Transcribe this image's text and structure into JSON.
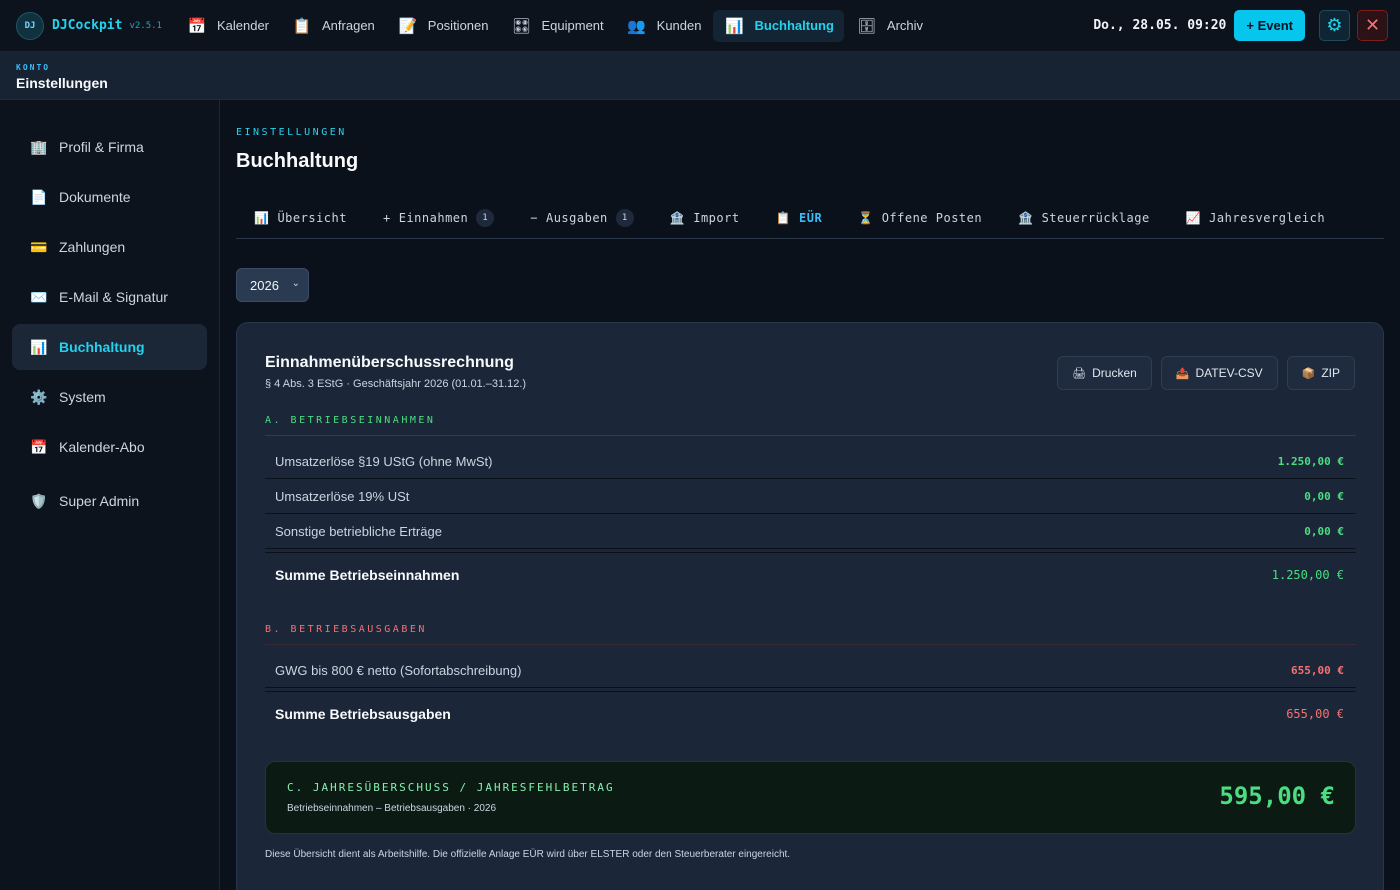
{
  "app": {
    "logo_badge": "DJ",
    "name": "DJCockpit",
    "version": "v2.5.1"
  },
  "nav": [
    {
      "label": "Kalender",
      "icon": "calendar-icon",
      "glyph": "📅"
    },
    {
      "label": "Anfragen",
      "icon": "clipboard-icon",
      "glyph": "📋"
    },
    {
      "label": "Positionen",
      "icon": "memo-icon",
      "glyph": "📝"
    },
    {
      "label": "Equipment",
      "icon": "speaker-icon",
      "glyph": "🎛"
    },
    {
      "label": "Kunden",
      "icon": "people-icon",
      "glyph": "👥"
    },
    {
      "label": "Buchhaltung",
      "icon": "chart-icon",
      "glyph": "📊",
      "active": true
    },
    {
      "label": "Archiv",
      "icon": "archive-icon",
      "glyph": "🗄"
    }
  ],
  "topbar": {
    "datetime": "Do., 28.05. 09:20",
    "event_button": "+ Event"
  },
  "subheader": {
    "kicker": "KONTO",
    "title": "Einstellungen"
  },
  "sidebar": [
    {
      "label": "Profil & Firma",
      "icon": "office-icon",
      "glyph": "🏢"
    },
    {
      "label": "Dokumente",
      "icon": "document-icon",
      "glyph": "📄"
    },
    {
      "label": "Zahlungen",
      "icon": "credit-card-icon",
      "glyph": "💳"
    },
    {
      "label": "E-Mail & Signatur",
      "icon": "mail-icon",
      "glyph": "✉️"
    },
    {
      "label": "Buchhaltung",
      "icon": "chart-icon",
      "glyph": "📊",
      "active": true
    },
    {
      "label": "System",
      "icon": "gear-icon",
      "glyph": "⚙️"
    },
    {
      "label": "Kalender-Abo",
      "icon": "calendar-icon",
      "glyph": "📅"
    },
    {
      "label": "Super Admin",
      "icon": "shield-icon",
      "glyph": "🛡️"
    }
  ],
  "page": {
    "kicker": "EINSTELLUNGEN",
    "title": "Buchhaltung"
  },
  "tabs": [
    {
      "label": "Übersicht",
      "glyph": "📊",
      "icon": "chart-icon"
    },
    {
      "label": "Einnahmen",
      "glyph": "+",
      "icon": "plus-icon",
      "count": "1"
    },
    {
      "label": "Ausgaben",
      "glyph": "−",
      "icon": "minus-icon",
      "count": "1"
    },
    {
      "label": "Import",
      "glyph": "🏦",
      "icon": "bank-icon"
    },
    {
      "label": "EÜR",
      "glyph": "📋",
      "icon": "clipboard-icon",
      "active": true
    },
    {
      "label": "Offene Posten",
      "glyph": "⏳",
      "icon": "hourglass-icon"
    },
    {
      "label": "Steuerrücklage",
      "glyph": "🏦",
      "icon": "bank-icon"
    },
    {
      "label": "Jahresvergleich",
      "glyph": "📈",
      "icon": "trend-icon"
    }
  ],
  "year_select": {
    "value": "2026"
  },
  "report": {
    "title": "Einnahmenüberschussrechnung",
    "subtitle": "§ 4 Abs. 3 EStG · Geschäftsjahr 2026 (01.01.–31.12.)",
    "actions": [
      {
        "label": "Drucken",
        "glyph": "🖨",
        "icon": "printer-icon"
      },
      {
        "label": "DATEV-CSV",
        "glyph": "📤",
        "icon": "export-icon"
      },
      {
        "label": "ZIP",
        "glyph": "📦",
        "icon": "package-icon"
      }
    ],
    "income": {
      "heading": "A. BETRIEBSEINNAHMEN",
      "rows": [
        {
          "label": "Umsatzerlöse §19 UStG (ohne MwSt)",
          "amount": "1.250,00 €"
        },
        {
          "label": "Umsatzerlöse 19% USt",
          "amount": "0,00 €"
        },
        {
          "label": "Sonstige betriebliche Erträge",
          "amount": "0,00 €"
        }
      ],
      "sum_label": "Summe Betriebseinnahmen",
      "sum_amount": "1.250,00 €"
    },
    "expenses": {
      "heading": "B. BETRIEBSAUSGABEN",
      "rows": [
        {
          "label": "GWG bis 800 € netto (Sofortabschreibung)",
          "amount": "655,00 €"
        }
      ],
      "sum_label": "Summe Betriebsausgaben",
      "sum_amount": "655,00 €"
    },
    "result": {
      "heading": "C. JAHRESÜBERSCHUSS / JAHRESFEHLBETRAG",
      "subtitle": "Betriebseinnahmen – Betriebsausgaben · 2026",
      "amount": "595,00 €"
    },
    "footnote": "Diese Übersicht dient als Arbeitshilfe. Die offizielle Anlage EÜR wird über ELSTER oder den Steuerberater eingereicht."
  },
  "colors": {
    "accent": "#22d3ee",
    "income": "#4ade80",
    "expense": "#f87171",
    "background": "#0b111a",
    "card": "#1b2638"
  }
}
